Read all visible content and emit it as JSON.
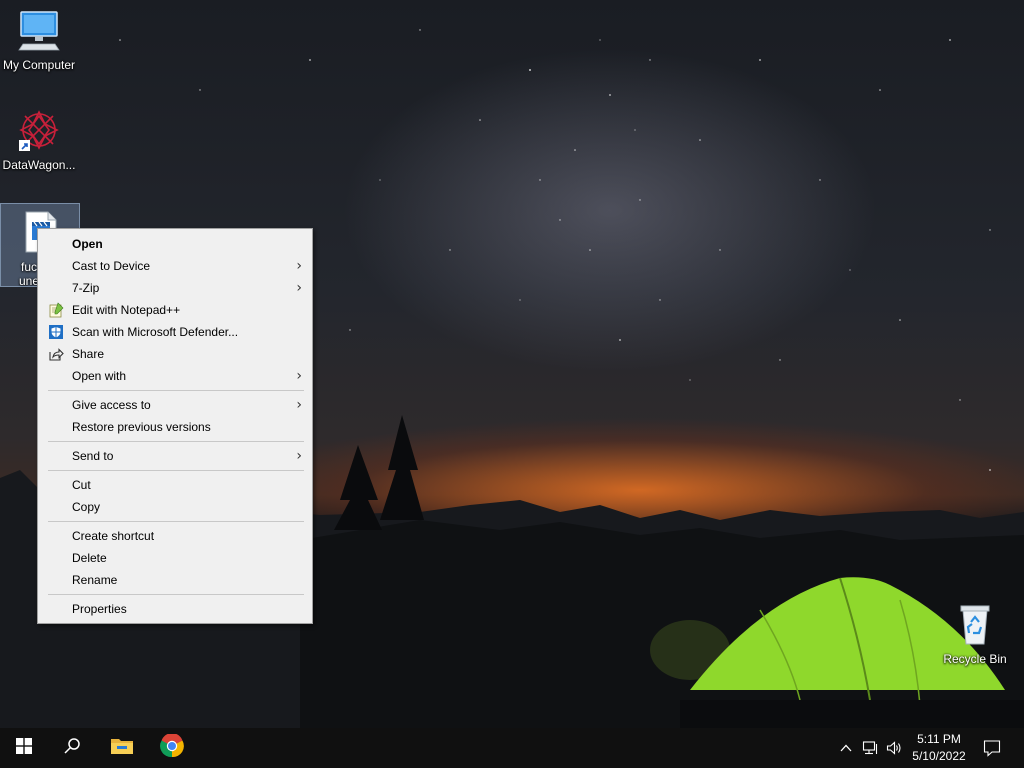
{
  "desktop": {
    "icons": [
      {
        "label": "My Computer",
        "icon": "computer-icon"
      },
      {
        "label": "DataWagon...",
        "icon": "datawagon-shortcut-icon"
      },
      {
        "label_line1": "fuc",
        "label_line2": "une",
        "icon": "video-file-icon",
        "selected": true
      },
      {
        "label": "Recycle Bin",
        "icon": "recycle-bin-icon"
      }
    ]
  },
  "context_menu": {
    "items": [
      {
        "label": "Open",
        "bold": true
      },
      {
        "label": "Cast to Device",
        "submenu": true
      },
      {
        "label": "7-Zip",
        "submenu": true
      },
      {
        "label": "Edit with Notepad++",
        "icon": "notepadpp-icon"
      },
      {
        "label": "Scan with Microsoft Defender...",
        "icon": "defender-icon"
      },
      {
        "label": "Share",
        "icon": "share-icon"
      },
      {
        "label": "Open with",
        "submenu": true
      },
      {
        "label": "Give access to",
        "submenu": true
      },
      {
        "label": "Restore previous versions"
      },
      {
        "label": "Send to",
        "submenu": true
      },
      {
        "label": "Cut"
      },
      {
        "label": "Copy"
      },
      {
        "label": "Create shortcut"
      },
      {
        "label": "Delete"
      },
      {
        "label": "Rename"
      },
      {
        "label": "Properties"
      }
    ],
    "submenu_arrow": "›"
  },
  "taskbar": {
    "start_icon": "windows-start-icon",
    "search_icon": "search-icon",
    "pinned": [
      "file-explorer-icon",
      "chrome-icon"
    ],
    "tray": [
      "chevron-up-icon",
      "network-icon",
      "volume-icon"
    ],
    "clock": {
      "time": "5:11 PM",
      "date": "5/10/2022"
    },
    "notifications_icon": "action-center-icon"
  },
  "colors": {
    "menu_bg": "#f0f0f0",
    "taskbar_bg": "#101010",
    "selection": "#8caad2",
    "tent": "#8fd82c"
  }
}
